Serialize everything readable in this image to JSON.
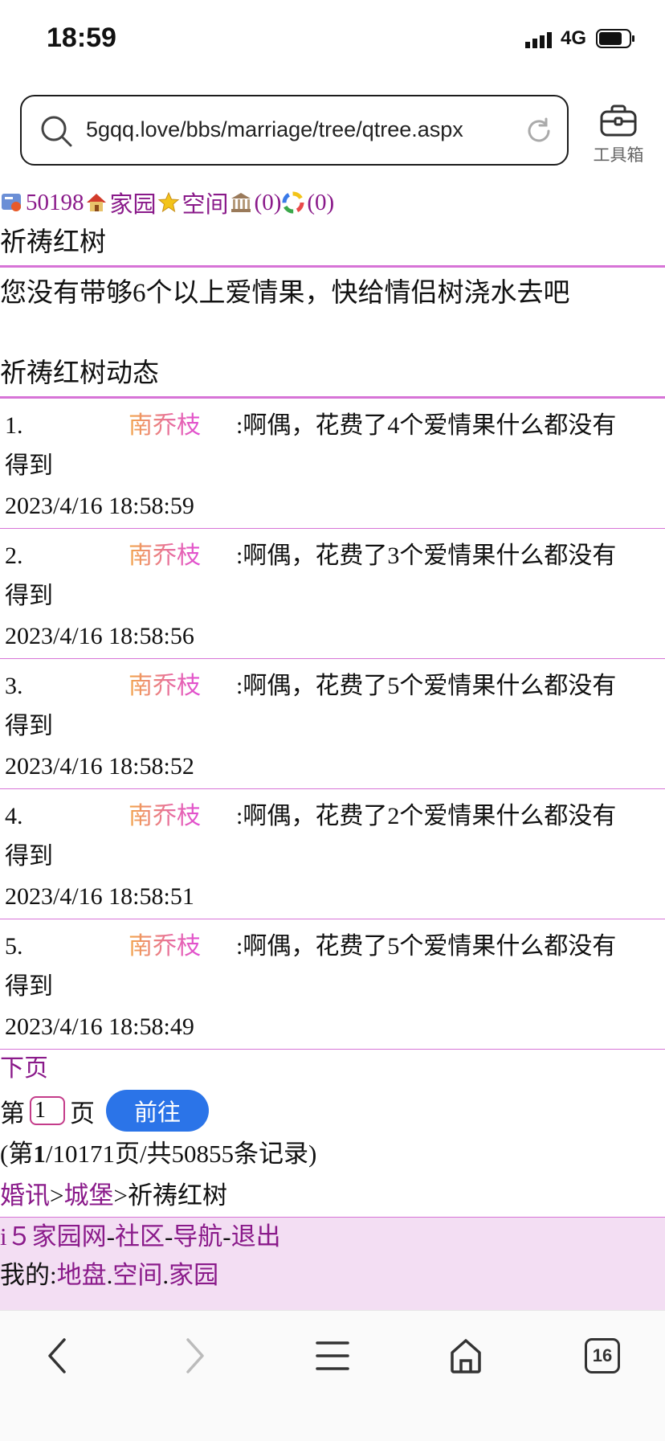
{
  "status": {
    "time": "18:59",
    "network": "4G"
  },
  "browser": {
    "url": "5gqq.love/bbs/marriage/tree/qtree.aspx",
    "toolbox_label": "工具箱",
    "tab_count": "16"
  },
  "nav": {
    "user_id": "50198",
    "home": "家园",
    "space": "空间",
    "bank_count": "(0)",
    "misc_count": "(0)"
  },
  "page_title": "祈祷红树",
  "message": "您没有带够6个以上爱情果，快给情侣树浇水去吧",
  "section_title": "祈祷红树动态",
  "records": [
    {
      "num": "1.",
      "name": "南乔枝",
      "text": ":啊偶，花费了4个爱情果什么都没有",
      "text2": "得到",
      "date": "2023/4/16 18:58:59"
    },
    {
      "num": "2.",
      "name": "南乔枝",
      "text": ":啊偶，花费了3个爱情果什么都没有",
      "text2": "得到",
      "date": "2023/4/16 18:58:56"
    },
    {
      "num": "3.",
      "name": "南乔枝",
      "text": ":啊偶，花费了5个爱情果什么都没有",
      "text2": "得到",
      "date": "2023/4/16 18:58:52"
    },
    {
      "num": "4.",
      "name": "南乔枝",
      "text": ":啊偶，花费了2个爱情果什么都没有",
      "text2": "得到",
      "date": "2023/4/16 18:58:51"
    },
    {
      "num": "5.",
      "name": "南乔枝",
      "text": ":啊偶，花费了5个爱情果什么都没有",
      "text2": "得到",
      "date": "2023/4/16 18:58:49"
    }
  ],
  "pager": {
    "next": "下页",
    "prefix": "第",
    "value": "1",
    "suffix": "页",
    "go": "前往",
    "summary_a": "(第",
    "summary_b": "1",
    "summary_c": "/10171页/共50855条记录)"
  },
  "breadcrumb": {
    "a": "婚讯",
    "sep1": ">",
    "b": "城堡",
    "sep2": ">",
    "c": "祈祷红树"
  },
  "footer": {
    "site": "i５家园网",
    "dash1": "-",
    "community": "社区",
    "dash2": "-",
    "navigation": "导航",
    "dash3": "-",
    "logout": "退出",
    "mine_label": "我的:",
    "land": "地盘",
    "dot1": ".",
    "space": "空间",
    "dot2": ".",
    "home": "家园"
  }
}
